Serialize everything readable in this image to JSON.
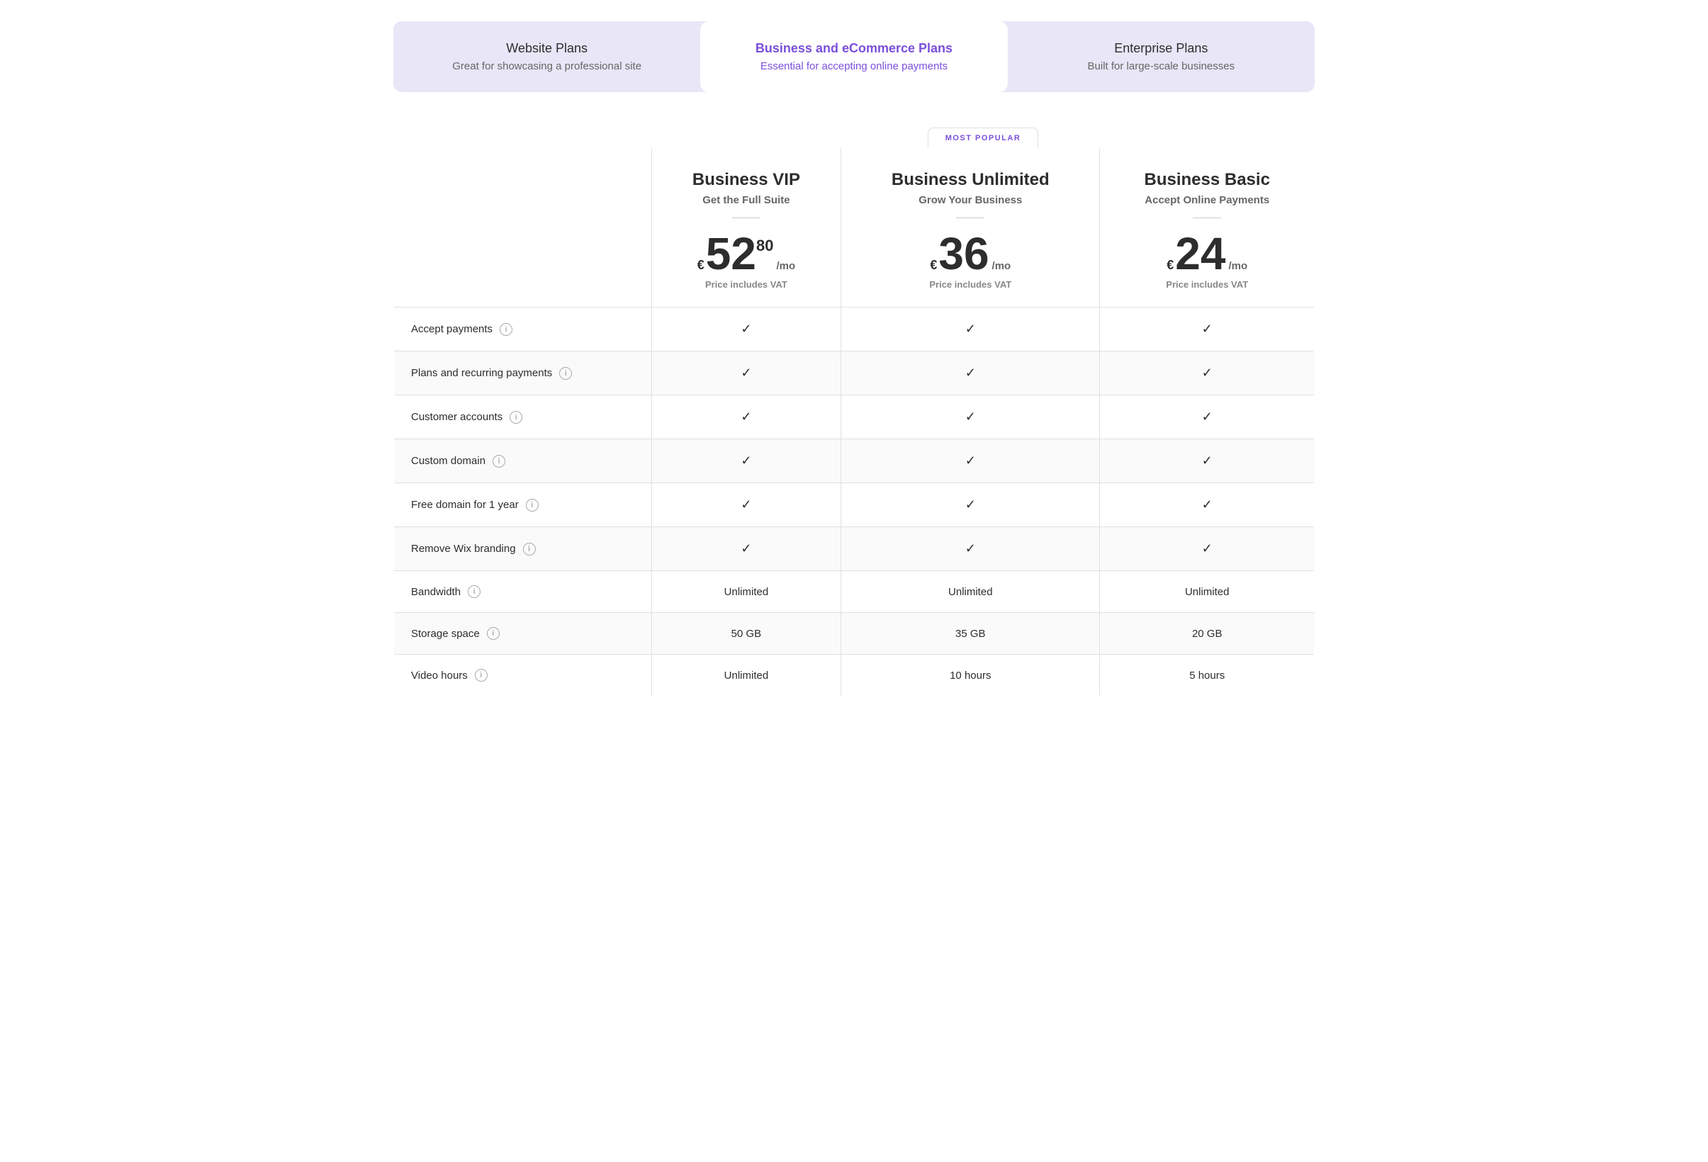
{
  "tabs": [
    {
      "id": "website",
      "title": "Website Plans",
      "subtitle": "Great for showcasing a professional site",
      "active": false
    },
    {
      "id": "business",
      "title": "Business and eCommerce Plans",
      "subtitle": "Essential for accepting online payments",
      "active": true
    },
    {
      "id": "enterprise",
      "title": "Enterprise Plans",
      "subtitle": "Built for large-scale businesses",
      "active": false
    }
  ],
  "most_popular_label": "MOST POPULAR",
  "plans": [
    {
      "id": "vip",
      "name": "Business VIP",
      "tagline": "Get the Full Suite",
      "currency": "€",
      "price_main": "52",
      "price_decimal": "80",
      "price_period": "/mo",
      "price_vat": "Price includes VAT"
    },
    {
      "id": "unlimited",
      "name": "Business Unlimited",
      "tagline": "Grow Your Business",
      "currency": "€",
      "price_main": "36",
      "price_decimal": "",
      "price_period": "/mo",
      "price_vat": "Price includes VAT"
    },
    {
      "id": "basic",
      "name": "Business Basic",
      "tagline": "Accept Online Payments",
      "currency": "€",
      "price_main": "24",
      "price_decimal": "",
      "price_period": "/mo",
      "price_vat": "Price includes VAT"
    }
  ],
  "features": [
    {
      "label": "Accept payments",
      "values": [
        "check",
        "check",
        "check"
      ]
    },
    {
      "label": "Plans and recurring payments",
      "values": [
        "check",
        "check",
        "check"
      ]
    },
    {
      "label": "Customer accounts",
      "values": [
        "check",
        "check",
        "check"
      ]
    },
    {
      "label": "Custom domain",
      "values": [
        "check",
        "check",
        "check"
      ]
    },
    {
      "label": "Free domain for 1 year",
      "values": [
        "check",
        "check",
        "check"
      ]
    },
    {
      "label": "Remove Wix branding",
      "values": [
        "check",
        "check",
        "check"
      ]
    },
    {
      "label": "Bandwidth",
      "values": [
        "Unlimited",
        "Unlimited",
        "Unlimited"
      ]
    },
    {
      "label": "Storage space",
      "values": [
        "50 GB",
        "35 GB",
        "20 GB"
      ]
    },
    {
      "label": "Video hours",
      "values": [
        "Unlimited",
        "10 hours",
        "5 hours"
      ]
    }
  ],
  "colors": {
    "purple": "#7b4fdc",
    "tab_bg": "#e8e6f7",
    "border": "#e0e0e0"
  }
}
